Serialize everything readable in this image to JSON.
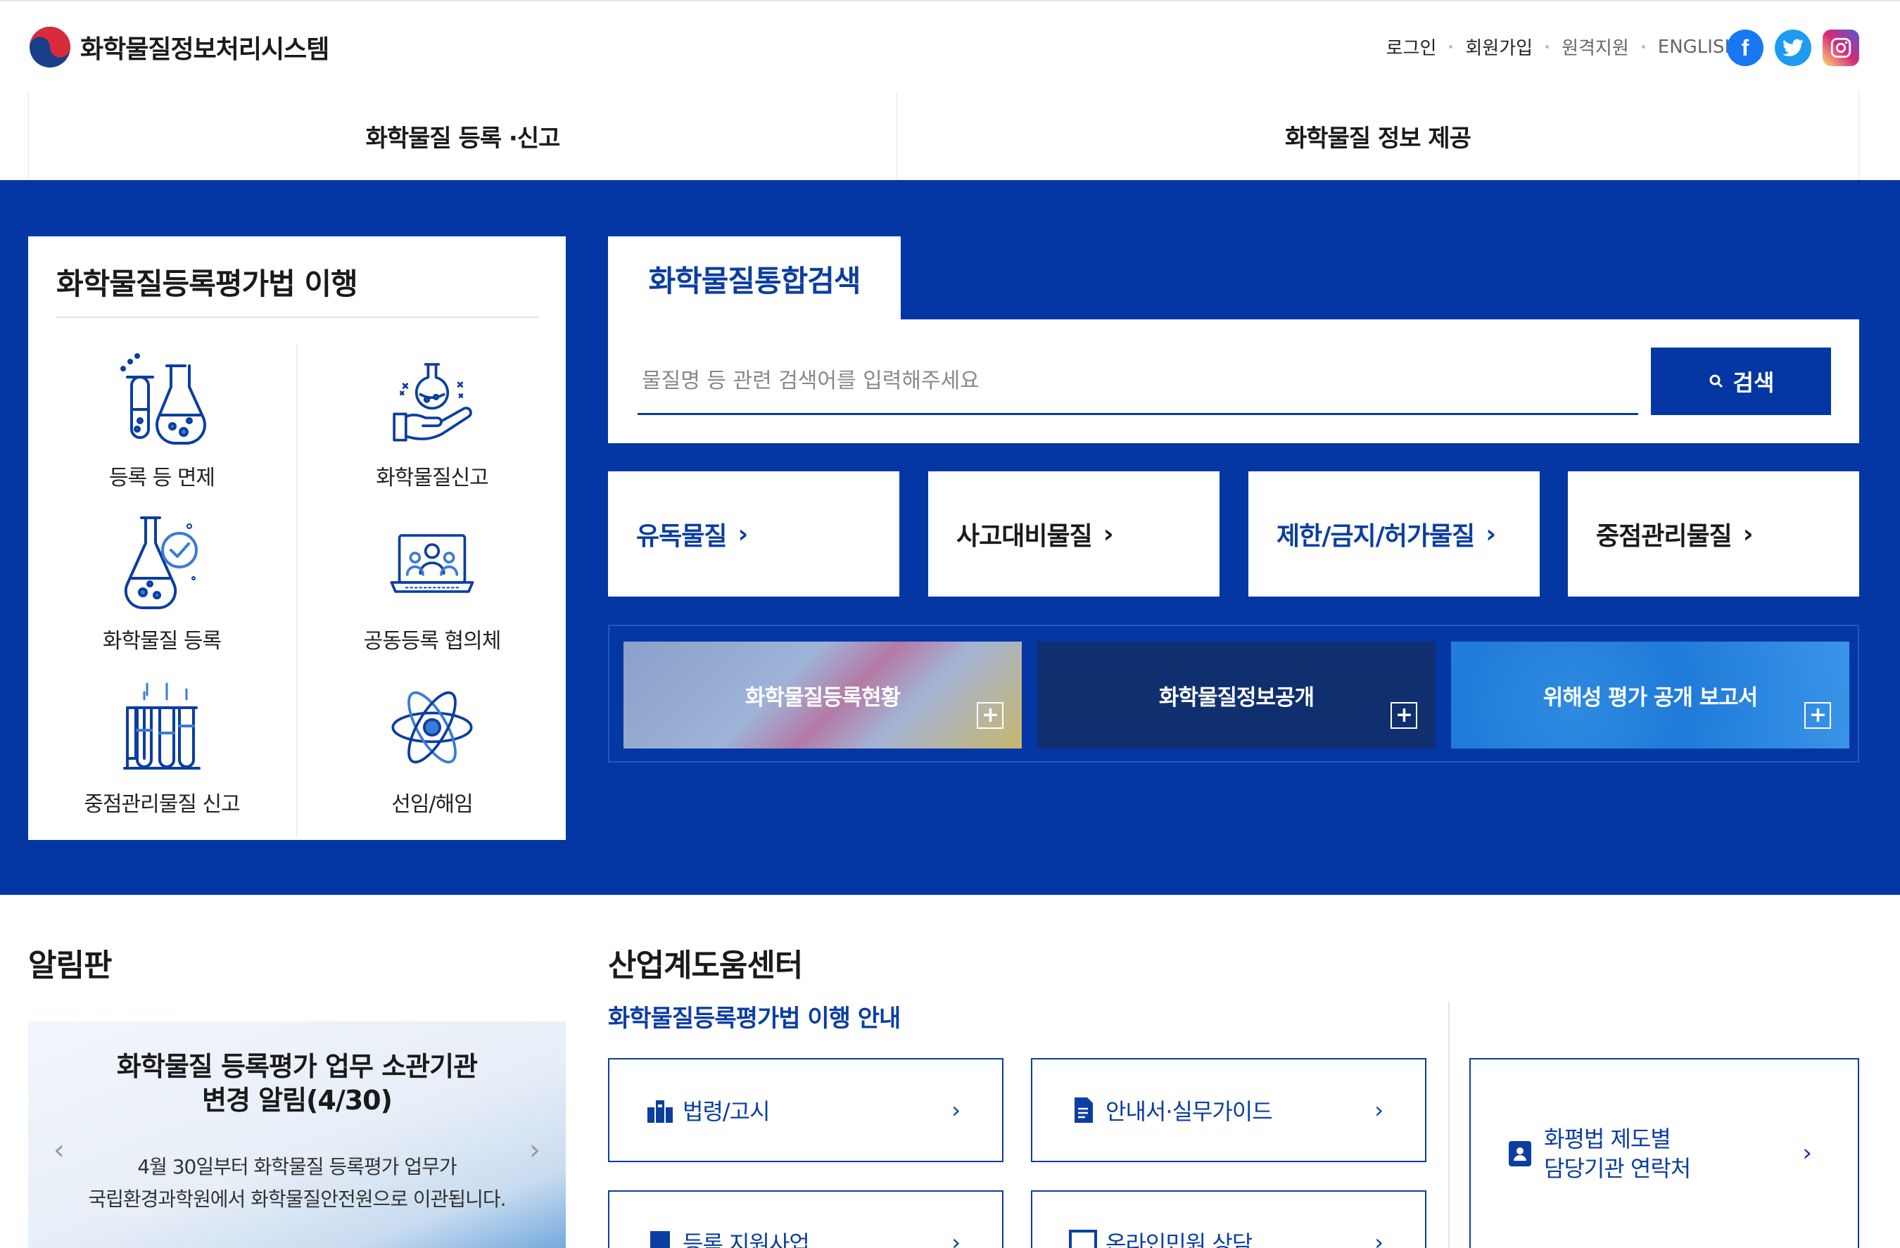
{
  "header": {
    "site_title": "화학물질정보처리시스템",
    "util_links": [
      "로그인",
      "회원가입",
      "원격지원",
      "ENGLISH"
    ],
    "social": [
      "facebook-icon",
      "twitter-icon",
      "instagram-icon"
    ]
  },
  "gnb": {
    "items": [
      "화학물질 등록 ·신고",
      "화학물질 정보 제공"
    ]
  },
  "panel": {
    "title": "화학물질등록평가법 이행",
    "items": [
      {
        "label": "등록 등 면제",
        "icon": "flasks-icon"
      },
      {
        "label": "화학물질신고",
        "icon": "hand-flask-icon"
      },
      {
        "label": "화학물질 등록",
        "icon": "flask-check-icon"
      },
      {
        "label": "공동등록 협의체",
        "icon": "laptop-group-icon"
      },
      {
        "label": "중점관리물질 신고",
        "icon": "test-tubes-icon"
      },
      {
        "label": "선임/해임",
        "icon": "atom-icon"
      }
    ]
  },
  "search": {
    "tab": "화학물질통합검색",
    "placeholder": "물질명 등 관련 검색어를 입력해주세요",
    "button": "검색"
  },
  "categories": [
    {
      "label": "유독물질",
      "color": "#0b3ea0"
    },
    {
      "label": "사고대비물질",
      "color": "#1a1a1a"
    },
    {
      "label": "제한/금지/허가물질",
      "color": "#0b3ea0"
    },
    {
      "label": "중점관리물질",
      "color": "#1a1a1a"
    }
  ],
  "banners": [
    "화학물질등록현황",
    "화학물질정보공개",
    "위해성 평가 공개 보고서"
  ],
  "notice": {
    "heading": "알림판",
    "title_line1": "화학물질 등록평가 업무 소관기관",
    "title_line2": "변경 알림(4/30)",
    "body_line1": "4월 30일부터 화학물질 등록평가 업무가",
    "body_line2": "국립환경과학원에서 화학물질안전원으로 이관됩니다."
  },
  "help": {
    "heading": "산업계도움센터",
    "subheading": "화학물질등록평가법 이행 안내",
    "links": [
      "법령/고시",
      "안내서·실무가이드",
      "등록 지원사업",
      "온라인민원 상담"
    ],
    "contact_line1": "화평법 제도별",
    "contact_line2": "담당기관 연락처"
  },
  "colors": {
    "primary": "#0437a3",
    "accent_text": "#0b3ea0",
    "banner_dark": "#102f6e"
  }
}
